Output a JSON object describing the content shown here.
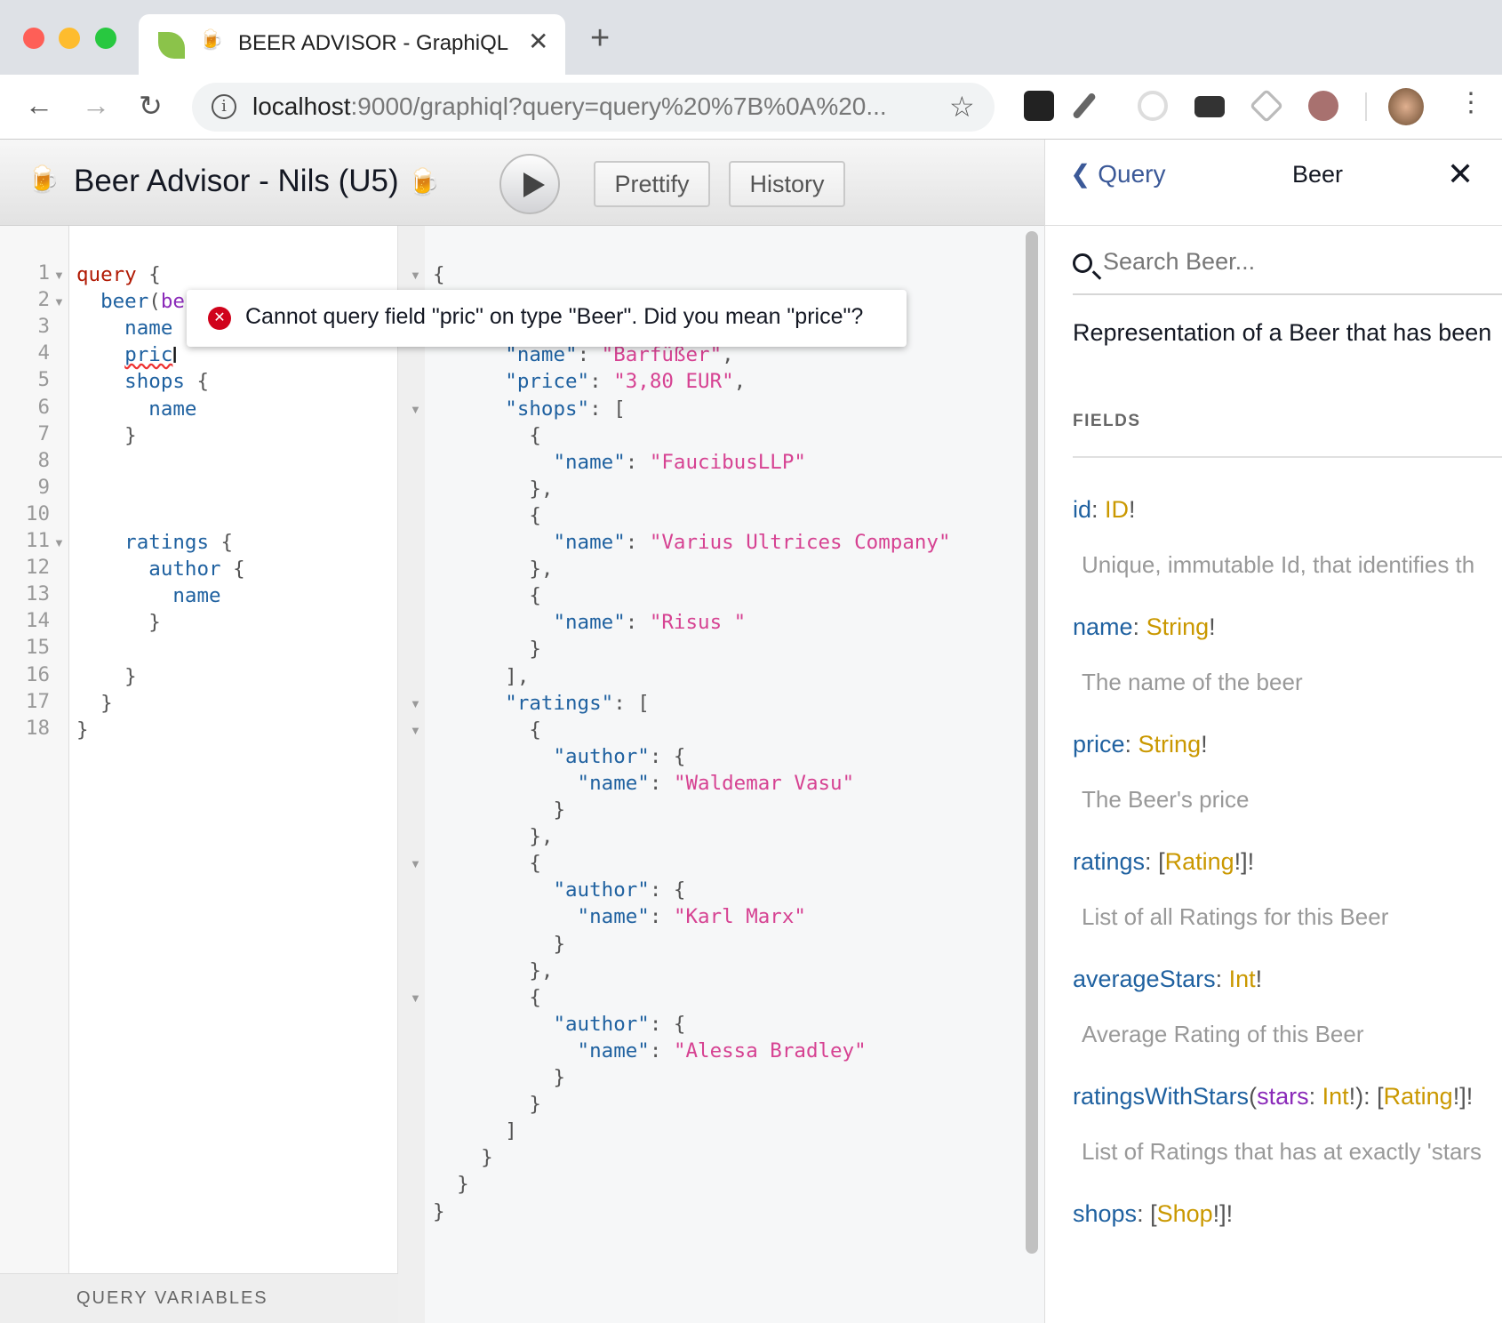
{
  "browser": {
    "tab_title": "BEER ADVISOR - GraphiQL",
    "tab_close": "✕",
    "new_tab": "+",
    "url_host": "localhost",
    "url_rest": ":9000/graphiql?query=query%20%7B%0A%20...",
    "window_controls": {
      "close": "#fe5f57",
      "minimize": "#febc2e",
      "maximize": "#28c840"
    },
    "extensions": [
      "react-devtools-icon",
      "eyedropper-icon",
      "target-icon",
      "mail-check-icon",
      "cube-icon",
      "play-record-icon"
    ]
  },
  "toolbar": {
    "title": "Beer Advisor - Nils (U5)",
    "beer_emoji": "🍺",
    "prettify_label": "Prettify",
    "history_label": "History"
  },
  "query_editor": {
    "lines": [
      [
        [
          "query",
          "kw"
        ],
        [
          " {",
          "pun"
        ]
      ],
      [
        [
          "  beer",
          "def"
        ],
        [
          "(",
          "pun"
        ],
        [
          "be",
          "attr"
        ]
      ],
      [
        [
          "    name",
          "def"
        ]
      ],
      [
        [
          "    ",
          "pun"
        ],
        [
          "pric",
          "def err"
        ]
      ],
      [
        [
          "    shops",
          "def"
        ],
        [
          " {",
          "pun"
        ]
      ],
      [
        [
          "      name",
          "def"
        ]
      ],
      [
        [
          "    }",
          "pun"
        ]
      ],
      [],
      [],
      [],
      [
        [
          "    ratings",
          "def"
        ],
        [
          " {",
          "pun"
        ]
      ],
      [
        [
          "      author",
          "def"
        ],
        [
          " {",
          "pun"
        ]
      ],
      [
        [
          "        name",
          "def"
        ]
      ],
      [
        [
          "      }",
          "pun"
        ]
      ],
      [],
      [
        [
          "    }",
          "pun"
        ]
      ],
      [
        [
          "  }",
          "pun"
        ]
      ],
      [
        [
          "}",
          "pun"
        ]
      ]
    ],
    "folds": [
      0,
      1,
      10
    ],
    "variables_label": "QUERY VARIABLES"
  },
  "error_tooltip": {
    "message": "Cannot query field \"pric\" on type \"Beer\". Did you mean \"price\"?"
  },
  "result": {
    "lines": [
      [
        [
          "{",
          "pun"
        ]
      ],
      [],
      [],
      [
        [
          "      \"name\"",
          "def"
        ],
        [
          ": ",
          "pun"
        ],
        [
          "\"Barfüßer\"",
          "str"
        ],
        [
          ",",
          "pun"
        ]
      ],
      [
        [
          "      \"price\"",
          "def"
        ],
        [
          ": ",
          "pun"
        ],
        [
          "\"3,80 EUR\"",
          "str"
        ],
        [
          ",",
          "pun"
        ]
      ],
      [
        [
          "      \"shops\"",
          "def"
        ],
        [
          ": [",
          "pun"
        ]
      ],
      [
        [
          "        {",
          "pun"
        ]
      ],
      [
        [
          "          \"name\"",
          "def"
        ],
        [
          ": ",
          "pun"
        ],
        [
          "\"FaucibusLLP\"",
          "str"
        ]
      ],
      [
        [
          "        },",
          "pun"
        ]
      ],
      [
        [
          "        {",
          "pun"
        ]
      ],
      [
        [
          "          \"name\"",
          "def"
        ],
        [
          ": ",
          "pun"
        ],
        [
          "\"Varius Ultrices Company\"",
          "str"
        ]
      ],
      [
        [
          "        },",
          "pun"
        ]
      ],
      [
        [
          "        {",
          "pun"
        ]
      ],
      [
        [
          "          \"name\"",
          "def"
        ],
        [
          ": ",
          "pun"
        ],
        [
          "\"Risus \"",
          "str"
        ]
      ],
      [
        [
          "        }",
          "pun"
        ]
      ],
      [
        [
          "      ],",
          "pun"
        ]
      ],
      [
        [
          "      \"ratings\"",
          "def"
        ],
        [
          ": [",
          "pun"
        ]
      ],
      [
        [
          "        {",
          "pun"
        ]
      ],
      [
        [
          "          \"author\"",
          "def"
        ],
        [
          ": {",
          "pun"
        ]
      ],
      [
        [
          "            \"name\"",
          "def"
        ],
        [
          ": ",
          "pun"
        ],
        [
          "\"Waldemar Vasu\"",
          "str"
        ]
      ],
      [
        [
          "          }",
          "pun"
        ]
      ],
      [
        [
          "        },",
          "pun"
        ]
      ],
      [
        [
          "        {",
          "pun"
        ]
      ],
      [
        [
          "          \"author\"",
          "def"
        ],
        [
          ": {",
          "pun"
        ]
      ],
      [
        [
          "            \"name\"",
          "def"
        ],
        [
          ": ",
          "pun"
        ],
        [
          "\"Karl Marx\"",
          "str"
        ]
      ],
      [
        [
          "          }",
          "pun"
        ]
      ],
      [
        [
          "        },",
          "pun"
        ]
      ],
      [
        [
          "        {",
          "pun"
        ]
      ],
      [
        [
          "          \"author\"",
          "def"
        ],
        [
          ": {",
          "pun"
        ]
      ],
      [
        [
          "            \"name\"",
          "def"
        ],
        [
          ": ",
          "pun"
        ],
        [
          "\"Alessa Bradley\"",
          "str"
        ]
      ],
      [
        [
          "          }",
          "pun"
        ]
      ],
      [
        [
          "        }",
          "pun"
        ]
      ],
      [
        [
          "      ]",
          "pun"
        ]
      ],
      [
        [
          "    }",
          "pun"
        ]
      ],
      [
        [
          "  }",
          "pun"
        ]
      ],
      [
        [
          "}",
          "pun"
        ]
      ]
    ],
    "folds": [
      0,
      5,
      16,
      17,
      22,
      27
    ]
  },
  "doc_explorer": {
    "back_label": "Query",
    "title": "Beer",
    "close": "✕",
    "search_placeholder": "Search Beer...",
    "description": "Representation of a Beer that has been",
    "fields_heading": "FIELDS",
    "fields": [
      {
        "name": "id",
        "sep": ": ",
        "pre": "",
        "type": "ID",
        "post": "!",
        "args": null,
        "desc": "Unique, immutable Id, that identifies th"
      },
      {
        "name": "name",
        "sep": ": ",
        "pre": "",
        "type": "String",
        "post": "!",
        "args": null,
        "desc": "The name of the beer"
      },
      {
        "name": "price",
        "sep": ": ",
        "pre": "",
        "type": "String",
        "post": "!",
        "args": null,
        "desc": "The Beer's price"
      },
      {
        "name": "ratings",
        "sep": ": ",
        "pre": "[",
        "type": "Rating",
        "post": "!]!",
        "args": null,
        "desc": "List of all Ratings for this Beer"
      },
      {
        "name": "averageStars",
        "sep": ": ",
        "pre": "",
        "type": "Int",
        "post": "!",
        "args": null,
        "desc": "Average Rating of this Beer"
      },
      {
        "name": "ratingsWithStars",
        "sep": "): ",
        "pre": "[",
        "type": "Rating",
        "post": "!]!",
        "args": {
          "open": "(",
          "name": "stars",
          "colon": ": ",
          "type": "Int",
          "bang": "!"
        },
        "desc": "List of Ratings that has at exactly 'stars"
      },
      {
        "name": "shops",
        "sep": ": ",
        "pre": "[",
        "type": "Shop",
        "post": "!]!",
        "args": null,
        "desc": ""
      }
    ]
  }
}
